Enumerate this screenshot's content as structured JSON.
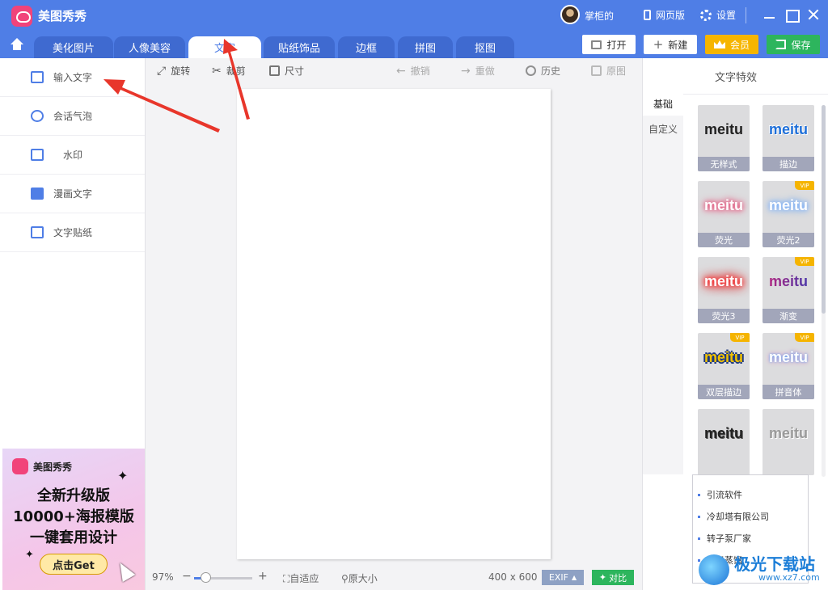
{
  "app": {
    "title": "美图秀秀",
    "user": "掌柜的",
    "web_version": "网页版",
    "settings": "设置"
  },
  "tabs": [
    "美化图片",
    "人像美容",
    "文字",
    "贴纸饰品",
    "边框",
    "拼图",
    "抠图"
  ],
  "active_tab": "文字",
  "actions": {
    "open": "打开",
    "new": "新建",
    "vip": "会员",
    "save": "保存"
  },
  "left_menu": [
    "输入文字",
    "会话气泡",
    "水印",
    "漫画文字",
    "文字贴纸"
  ],
  "ad": {
    "brand": "美图秀秀",
    "line1": "全新升级版",
    "line2": "10000+海报模版",
    "line3": "一键套用设计",
    "button": "点击Get"
  },
  "toolbar": {
    "rotate": "旋转",
    "crop": "裁剪",
    "size": "尺寸",
    "undo": "撤销",
    "redo": "重做",
    "history": "历史",
    "original": "原图"
  },
  "status": {
    "zoom": "97%",
    "zoom_level": 0.2,
    "fit": "自适应",
    "actual": "原大小",
    "dims": "400 x 600",
    "exif": "EXIF",
    "compare": "对比"
  },
  "right_panel": {
    "title": "文字特效",
    "subtabs": [
      "基础",
      "自定义"
    ],
    "styles": [
      {
        "sample": "meitu",
        "label": "无样式",
        "vip": false,
        "color": "#222222"
      },
      {
        "sample": "meitu",
        "label": "描边",
        "vip": false,
        "color": "#1e6fd9"
      },
      {
        "sample": "meitu",
        "label": "荧光",
        "vip": false,
        "color": "#ffffff"
      },
      {
        "sample": "meitu",
        "label": "荧光2",
        "vip": true,
        "color": "#ffffff"
      },
      {
        "sample": "meitu",
        "label": "荧光3",
        "vip": false,
        "color": "#ffffff"
      },
      {
        "sample": "meitu",
        "label": "渐变",
        "vip": true,
        "color": "#9a2a7a"
      },
      {
        "sample": "meitu",
        "label": "双层描边",
        "vip": true,
        "color": "#f2c200"
      },
      {
        "sample": "meitu",
        "label": "拼音体",
        "vip": true,
        "color": "#ffffff"
      },
      {
        "sample": "meitu",
        "label": "",
        "vip": false,
        "color": "#222222"
      },
      {
        "sample": "meitu",
        "label": "",
        "vip": false,
        "color": "#9a9a9a"
      }
    ],
    "vip_tag": "VIP",
    "links": [
      "引流软件",
      "冷却塔有限公司",
      "转子泵厂家",
      "分子蒸馏"
    ]
  },
  "watermark": {
    "text": "极光下载站",
    "url": "www.xz7.com"
  },
  "colors": {
    "brand_blue": "#4f7ee6",
    "vip_gold": "#f6b500",
    "save_green": "#2db55d",
    "annotation_red": "#e8362b"
  }
}
